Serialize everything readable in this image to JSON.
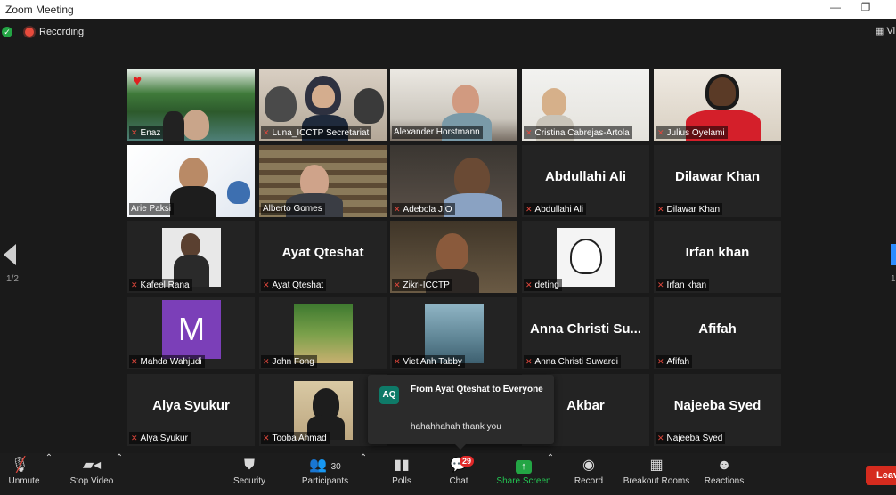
{
  "window": {
    "title": "Zoom Meeting",
    "minimize_glyph": "—",
    "restore_glyph": "❐"
  },
  "topbar": {
    "recording_label": "Recording",
    "view_label": "Vi"
  },
  "pagination": {
    "left": "1/2",
    "right": "1"
  },
  "tiles": [
    {
      "name": "Enaz",
      "muted": true,
      "big": ""
    },
    {
      "name": "Luna_ICCTP Secretariat",
      "muted": true,
      "big": ""
    },
    {
      "name": "Alexander Horstmann",
      "muted": false,
      "big": ""
    },
    {
      "name": "Cristina Cabrejas-Artola",
      "muted": true,
      "big": ""
    },
    {
      "name": "Julius Oyelami",
      "muted": true,
      "big": ""
    },
    {
      "name": "Arie Paksi",
      "muted": false,
      "big": ""
    },
    {
      "name": "Alberto Gomes",
      "muted": false,
      "big": ""
    },
    {
      "name": "Adebola J.O",
      "muted": true,
      "big": ""
    },
    {
      "name": "Abdullahi Ali",
      "muted": true,
      "big": "Abdullahi Ali"
    },
    {
      "name": "Dilawar Khan",
      "muted": true,
      "big": "Dilawar Khan"
    },
    {
      "name": "Kafeel Rana",
      "muted": true,
      "big": ""
    },
    {
      "name": "Ayat Qteshat",
      "muted": true,
      "big": "Ayat Qteshat"
    },
    {
      "name": "Zikri-ICCTP",
      "muted": true,
      "big": ""
    },
    {
      "name": "deting",
      "muted": true,
      "big": ""
    },
    {
      "name": "Irfan khan",
      "muted": true,
      "big": "Irfan khan"
    },
    {
      "name": "Mahda Wahjudi",
      "muted": true,
      "big": "",
      "avatar": "M"
    },
    {
      "name": "John Fong",
      "muted": true,
      "big": ""
    },
    {
      "name": "Viet Anh Tabby",
      "muted": true,
      "big": ""
    },
    {
      "name": "Anna Christi Suwardi",
      "muted": true,
      "big": "Anna Christi Su..."
    },
    {
      "name": "Afifah",
      "muted": true,
      "big": "Afifah"
    },
    {
      "name": "Alya Syukur",
      "muted": true,
      "big": "Alya Syukur"
    },
    {
      "name": "Tooba Ahmad",
      "muted": true,
      "big": ""
    },
    {
      "name": "bar",
      "muted": false,
      "big": "Akbar"
    },
    {
      "name": "Najeeba Syed",
      "muted": true,
      "big": "Najeeba Syed"
    }
  ],
  "chat_popup": {
    "initials": "AQ",
    "from": "From Ayat Qteshat to Everyone",
    "message": "hahahhahah thank you"
  },
  "toolbar": {
    "unmute": "Unmute",
    "stop_video": "Stop Video",
    "security": "Security",
    "participants": "Participants",
    "participants_count": "30",
    "polls": "Polls",
    "chat": "Chat",
    "chat_badge": "29",
    "share_screen": "Share Screen",
    "record": "Record",
    "breakout_rooms": "Breakout Rooms",
    "reactions": "Reactions",
    "leave": "Leave"
  },
  "colors": {
    "accent": "#2d8cff",
    "share_green": "#23a544",
    "active_speaker": "#c7e35c",
    "leave_red": "#d52b1e",
    "badge_red": "#e02828"
  }
}
